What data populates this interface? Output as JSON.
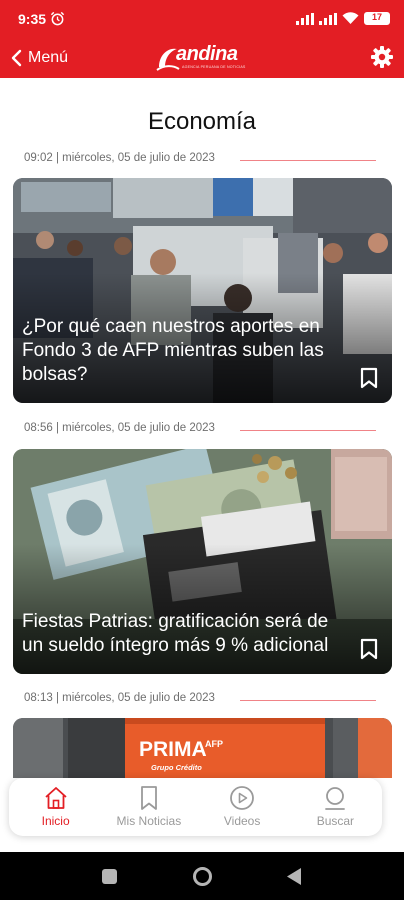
{
  "status_bar": {
    "time": "9:35",
    "battery": "17"
  },
  "app_bar": {
    "back_label": "Menú",
    "logo_text": "andina",
    "logo_subtitle": "AGENCIA PERUANA DE NOTICIAS"
  },
  "section": {
    "title": "Economía"
  },
  "articles": [
    {
      "meta": "09:02 | miércoles, 05 de julio de 2023",
      "title": "¿Por qué caen nuestros aportes en Fondo 3 de AFP mientras suben las bolsas?"
    },
    {
      "meta": "08:56 | miércoles, 05 de julio de 2023",
      "title": "Fiestas Patrias: gratificación será de un sueldo íntegro más 9 % adicional"
    },
    {
      "meta": "08:13 | miércoles, 05 de julio de 2023",
      "image_text": "PRIMA",
      "image_text_sup": "AFP",
      "image_text_sub": "Grupo Crédito"
    }
  ],
  "bottom_nav": [
    {
      "label": "Inicio",
      "icon": "home-icon",
      "active": true
    },
    {
      "label": "Mis Noticias",
      "icon": "bookmark-icon",
      "active": false
    },
    {
      "label": "Videos",
      "icon": "play-icon",
      "active": false
    },
    {
      "label": "Buscar",
      "icon": "search-icon",
      "active": false
    }
  ],
  "colors": {
    "accent": "#e31e24",
    "inactive": "#9a9a9a"
  }
}
